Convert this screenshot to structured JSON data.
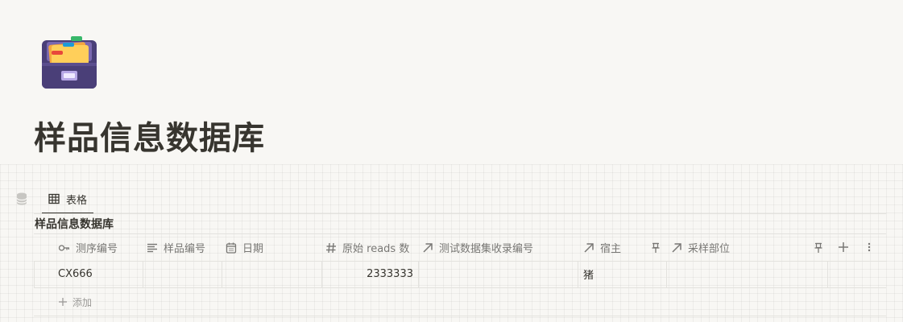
{
  "page": {
    "title": "样品信息数据库",
    "icon": "card-file-box-icon"
  },
  "view": {
    "tab_label": "表格",
    "tab_icon": "table-icon",
    "database_icon": "database-icon"
  },
  "database": {
    "title": "样品信息数据库",
    "columns": [
      {
        "label": "测序编号",
        "icon": "key-icon"
      },
      {
        "label": "样品编号",
        "icon": "text-lines-icon"
      },
      {
        "label": "日期",
        "icon": "calendar-icon"
      },
      {
        "label": "原始 reads 数",
        "icon": "hash-icon"
      },
      {
        "label": "测试数据集收录编号",
        "icon": "relation-arrow-icon"
      },
      {
        "label": "宿主",
        "icon": "relation-arrow-icon"
      },
      {
        "label": "采样部位",
        "icon": "relation-arrow-icon"
      }
    ],
    "rows": [
      {
        "cells": [
          "CX666",
          "",
          "",
          "2333333",
          "",
          "猪",
          ""
        ]
      }
    ],
    "add_label": "添加"
  },
  "colors": {
    "background": "#f8f7f4",
    "text": "#37352f",
    "muted": "#787774",
    "divider": "#e3e2de"
  }
}
